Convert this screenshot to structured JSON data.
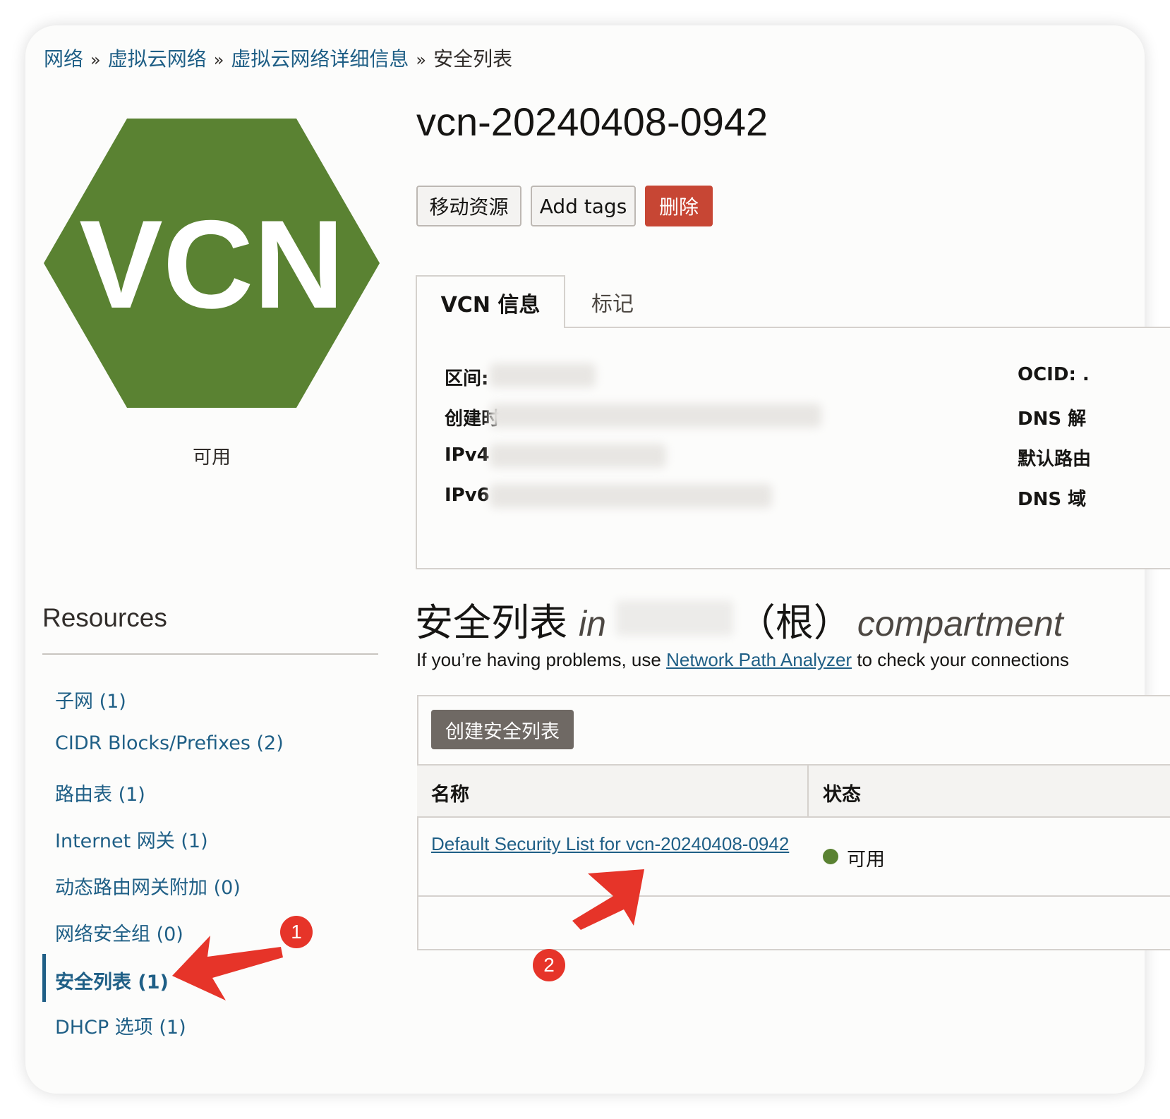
{
  "breadcrumb": {
    "items": [
      "网络",
      "虚拟云网络",
      "虚拟云网络详细信息"
    ],
    "current": "安全列表",
    "separator": "»"
  },
  "logo": {
    "text": "VCN",
    "color": "#5a8232"
  },
  "resource_status": "可用",
  "title": "vcn-20240408-0942",
  "actions": {
    "move": "移动资源",
    "add_tags": "Add tags",
    "delete": "删除"
  },
  "tabs": {
    "info": "VCN 信息",
    "tags": "标记"
  },
  "info": {
    "left_labels": [
      "区间:",
      "创建时",
      "IPv4",
      "IPv6"
    ],
    "right_labels": [
      "OCID: .",
      "DNS 解",
      "默认路由",
      "DNS 域"
    ]
  },
  "resources": {
    "title": "Resources",
    "items": [
      "子网 (1)",
      "CIDR Blocks/Prefixes (2)",
      "路由表 (1)",
      "Internet 网关 (1)",
      "动态路由网关附加 (0)",
      "网络安全组 (0)",
      "安全列表 (1)",
      "DHCP 选项 (1)"
    ]
  },
  "section": {
    "title": "安全列表",
    "in": "in",
    "root": "（根）",
    "compartment": "compartment",
    "help_prefix": "If you’re having problems, use ",
    "help_link": "Network Path Analyzer",
    "help_suffix": " to check your connections"
  },
  "table": {
    "create_button": "创建安全列表",
    "headers": [
      "名称",
      "状态"
    ],
    "rows": [
      {
        "name": "Default Security List for vcn-20240408-0942",
        "status": "可用"
      }
    ]
  },
  "annotations": [
    "1",
    "2"
  ],
  "colors": {
    "link": "#1f5f86",
    "danger": "#c74634",
    "available": "#5a8232",
    "annotation": "#e63429"
  }
}
